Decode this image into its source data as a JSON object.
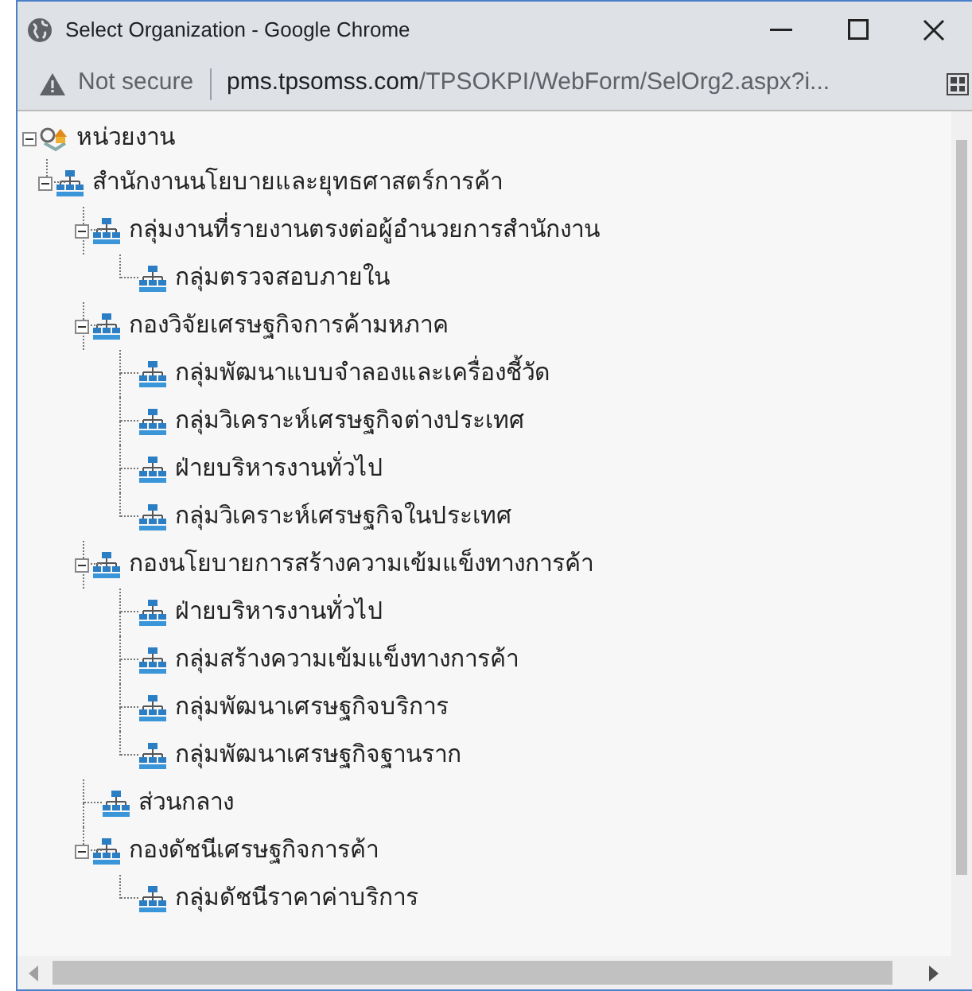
{
  "window": {
    "title": "Select Organization - Google Chrome"
  },
  "address_bar": {
    "security": "Not secure",
    "url_host": "pms.tpsomss.com",
    "url_path": "/TPSOKPI/WebForm/SelOrg2.aspx?i..."
  },
  "tree": [
    {
      "label": "หน่วยงาน",
      "kind": "root",
      "expanded": true,
      "children": [
        {
          "label": "สำนักงานนโยบายและยุทธศาสตร์การค้า",
          "kind": "org",
          "expanded": true,
          "children": [
            {
              "label": "กลุ่มงานที่รายงานตรงต่อผู้อำนวยการสำนักงาน",
              "kind": "org",
              "expanded": true,
              "children": [
                {
                  "label": "กลุ่มตรวจสอบภายใน",
                  "kind": "org"
                }
              ]
            },
            {
              "label": "กองวิจัยเศรษฐกิจการค้ามหภาค",
              "kind": "org",
              "expanded": true,
              "children": [
                {
                  "label": "กลุ่มพัฒนาแบบจำลองและเครื่องชี้วัด",
                  "kind": "org"
                },
                {
                  "label": "กลุ่มวิเคราะห์เศรษฐกิจต่างประเทศ",
                  "kind": "org"
                },
                {
                  "label": "ฝ่ายบริหารงานทั่วไป",
                  "kind": "org"
                },
                {
                  "label": "กลุ่มวิเคราะห์เศรษฐกิจในประเทศ",
                  "kind": "org"
                }
              ]
            },
            {
              "label": "กองนโยบายการสร้างความเข้มแข็งทางการค้า",
              "kind": "org",
              "expanded": true,
              "children": [
                {
                  "label": "ฝ่ายบริหารงานทั่วไป",
                  "kind": "org"
                },
                {
                  "label": "กลุ่มสร้างความเข้มแข็งทางการค้า",
                  "kind": "org"
                },
                {
                  "label": "กลุ่มพัฒนาเศรษฐกิจบริการ",
                  "kind": "org"
                },
                {
                  "label": "กลุ่มพัฒนาเศรษฐกิจฐานราก",
                  "kind": "org"
                }
              ]
            },
            {
              "label": "ส่วนกลาง",
              "kind": "org"
            },
            {
              "label": "กองดัชนีเศรษฐกิจการค้า",
              "kind": "org",
              "expanded": true,
              "children": [
                {
                  "label": "กลุ่มดัชนีราคาค่าบริการ",
                  "kind": "org"
                }
              ]
            }
          ]
        }
      ]
    }
  ]
}
